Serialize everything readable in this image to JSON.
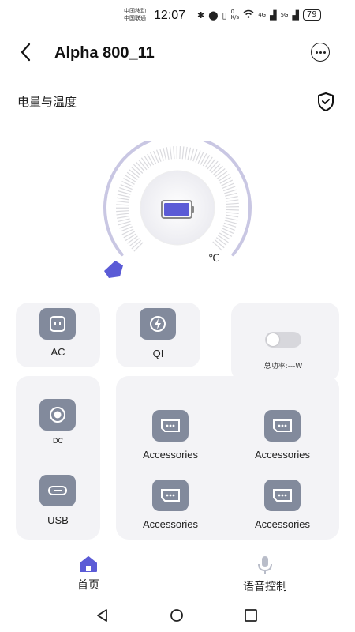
{
  "status": {
    "carrier1": "中国移动",
    "carrier2": "中国联通",
    "time": "12:07",
    "net_speed_top": "0",
    "net_speed_unit": "K/s",
    "signal1": "4G",
    "signal2": "5G",
    "battery": "79"
  },
  "header": {
    "title": "Alpha 800_11"
  },
  "section": {
    "title": "电量与温度"
  },
  "dial": {
    "temp_unit": "℃"
  },
  "ports": {
    "ac": "AC",
    "qi": "QI",
    "dc": "DC",
    "usb": "USB",
    "acc1": "Accessories",
    "acc2": "Accessories",
    "acc3": "Accessories",
    "acc4": "Accessories"
  },
  "power": {
    "total_label": "总功率:---W",
    "toggle_on": false
  },
  "nav": {
    "home": "首页",
    "voice": "语音控制"
  },
  "colors": {
    "accent": "#5b5bd6",
    "icon_bg": "#828a9c",
    "card_bg": "#f3f3f6"
  }
}
